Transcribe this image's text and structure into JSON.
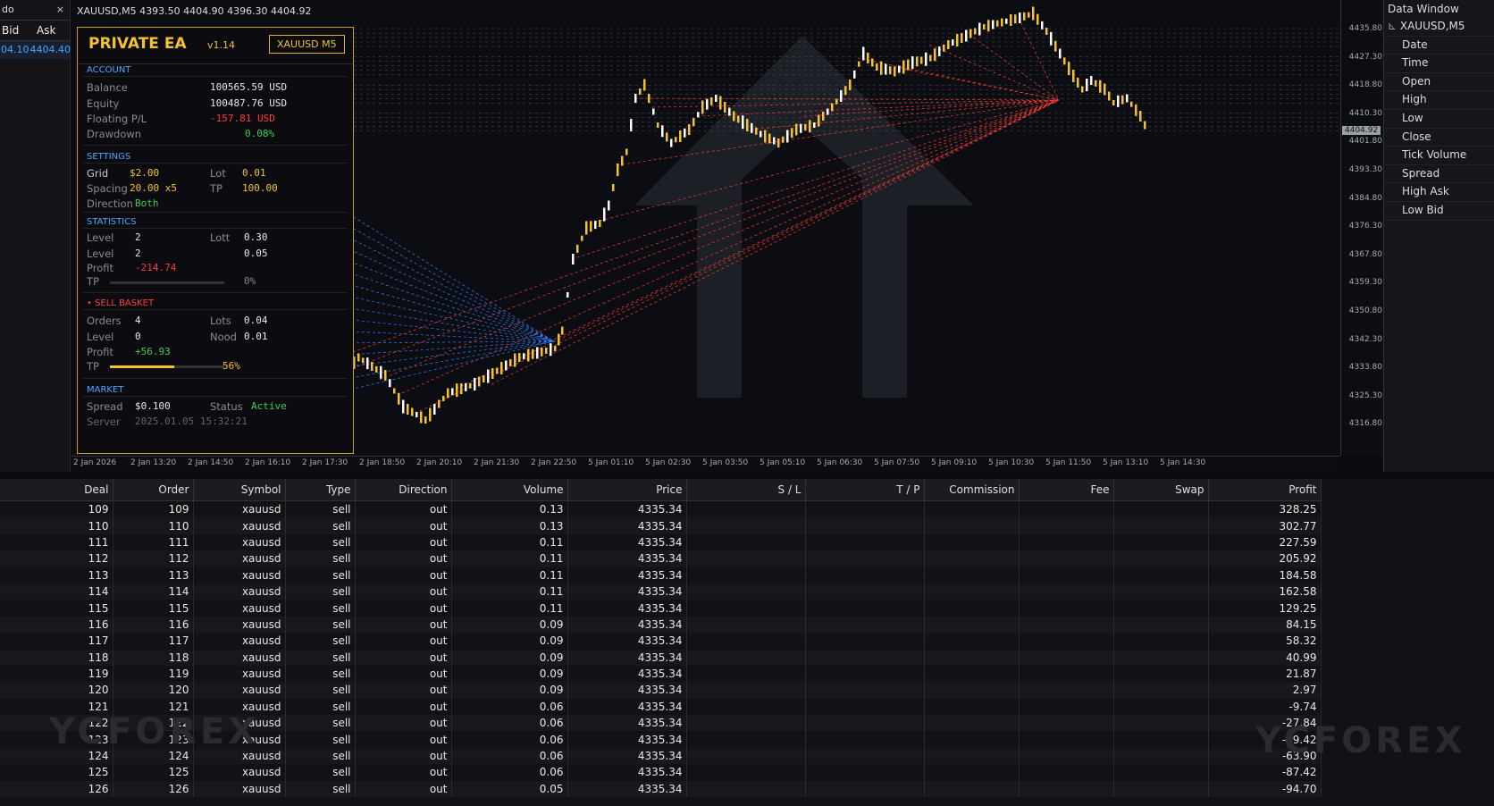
{
  "market_watch": {
    "title": "do",
    "close": "×",
    "col_bid": "Bid",
    "col_ask": "Ask",
    "bid": "04.10",
    "ask": "4404.40"
  },
  "chart": {
    "symbol_line": "XAUUSD,M5  4393.50 4404.90 4396.30 4404.92",
    "current_price": "4404.92",
    "price_ticks": [
      "4435.80",
      "4427.30",
      "4418.80",
      "4410.30",
      "4401.80",
      "4393.30",
      "4384.80",
      "4376.30",
      "4367.80",
      "4359.30",
      "4350.80",
      "4342.30",
      "4333.80",
      "4325.30",
      "4316.80"
    ],
    "time_ticks": [
      "2 Jan 2026",
      "2 Jan 13:20",
      "2 Jan 14:50",
      "2 Jan 16:10",
      "2 Jan 17:30",
      "2 Jan 18:50",
      "2 Jan 20:10",
      "2 Jan 21:30",
      "2 Jan 22:50",
      "5 Jan 01:10",
      "5 Jan 02:30",
      "5 Jan 03:50",
      "5 Jan 05:10",
      "5 Jan 06:30",
      "5 Jan 07:50",
      "5 Jan 09:10",
      "5 Jan 10:30",
      "5 Jan 11:50",
      "5 Jan 13:10",
      "5 Jan 14:30"
    ],
    "colors": {
      "bull": "#f2c231",
      "bear": "#ffffff",
      "sell_line": "#ff3b30",
      "buy_line": "#2f80ff"
    }
  },
  "data_window": {
    "title": "Data Window",
    "symbol": "XAUUSD,M5",
    "items": [
      "Date",
      "Time",
      "Open",
      "High",
      "Low",
      "Close",
      "Tick Volume",
      "Spread",
      "High Ask",
      "Low Bid"
    ]
  },
  "ea": {
    "name": "PRIVATE EA",
    "version": "v1.14",
    "pair": "XAUUSD M5",
    "account": {
      "title": "ACCOUNT",
      "balance_label": "Balance",
      "balance": "100565.59 USD",
      "equity_label": "Equity",
      "equity": "100487.76 USD",
      "fpl_label": "Floating P/L",
      "fpl": "-157.81 USD",
      "dd_label": "Drawdown",
      "dd": "0.08%"
    },
    "settings": {
      "title": "SETTINGS",
      "grid_label": "Grid",
      "grid": "$2.00",
      "lot_label": "Lot",
      "lot": "0.01",
      "spacing_label": "Spacing",
      "spacing": "20.00 x5",
      "tp_label": "TP",
      "tp": "100.00",
      "dir_label": "Direction",
      "dir": "Both"
    },
    "stats": {
      "title": "STATISTICS",
      "level_label": "Level",
      "level": "2",
      "lott_label": "Lott",
      "lott": "0.30",
      "level2_label": "Level",
      "level2": "2",
      "v2": "0.05",
      "profit_label": "Profit",
      "profit": "-214.74",
      "tp_label": "TP",
      "tp_pct": "0%",
      "tp_fill": 0.0
    },
    "sell": {
      "title": "SELL BASKET",
      "orders_label": "Orders",
      "orders": "4",
      "lots_label": "Lots",
      "lots": "0.04",
      "level_label": "Level",
      "level": "0",
      "nood_label": "Nood",
      "nood": "0.01",
      "profit_label": "Profit",
      "profit": "+56.93",
      "tp_label": "TP",
      "tp_pct": "56%",
      "tp_fill": 0.56
    },
    "market": {
      "title": "MARKET",
      "spread_label": "Spread",
      "spread": "$0.100",
      "status_label": "Status",
      "status": "Active",
      "server_label": "Server",
      "server": "2025.01.05 15:32:21"
    }
  },
  "table": {
    "headers": [
      "Deal",
      "Order",
      "Symbol",
      "Type",
      "Direction",
      "Volume",
      "Price",
      "S / L",
      "T / P",
      "Commission",
      "Fee",
      "Swap",
      "Profit"
    ],
    "rows": [
      [
        "109",
        "109",
        "xauusd",
        "sell",
        "out",
        "0.13",
        "4335.34",
        "",
        "",
        "",
        "",
        "",
        "328.25"
      ],
      [
        "110",
        "110",
        "xauusd",
        "sell",
        "out",
        "0.13",
        "4335.34",
        "",
        "",
        "",
        "",
        "",
        "302.77"
      ],
      [
        "111",
        "111",
        "xauusd",
        "sell",
        "out",
        "0.11",
        "4335.34",
        "",
        "",
        "",
        "",
        "",
        "227.59"
      ],
      [
        "112",
        "112",
        "xauusd",
        "sell",
        "out",
        "0.11",
        "4335.34",
        "",
        "",
        "",
        "",
        "",
        "205.92"
      ],
      [
        "113",
        "113",
        "xauusd",
        "sell",
        "out",
        "0.11",
        "4335.34",
        "",
        "",
        "",
        "",
        "",
        "184.58"
      ],
      [
        "114",
        "114",
        "xauusd",
        "sell",
        "out",
        "0.11",
        "4335.34",
        "",
        "",
        "",
        "",
        "",
        "162.58"
      ],
      [
        "115",
        "115",
        "xauusd",
        "sell",
        "out",
        "0.11",
        "4335.34",
        "",
        "",
        "",
        "",
        "",
        "129.25"
      ],
      [
        "116",
        "116",
        "xauusd",
        "sell",
        "out",
        "0.09",
        "4335.34",
        "",
        "",
        "",
        "",
        "",
        "84.15"
      ],
      [
        "117",
        "117",
        "xauusd",
        "sell",
        "out",
        "0.09",
        "4335.34",
        "",
        "",
        "",
        "",
        "",
        "58.32"
      ],
      [
        "118",
        "118",
        "xauusd",
        "sell",
        "out",
        "0.09",
        "4335.34",
        "",
        "",
        "",
        "",
        "",
        "40.99"
      ],
      [
        "119",
        "119",
        "xauusd",
        "sell",
        "out",
        "0.09",
        "4335.34",
        "",
        "",
        "",
        "",
        "",
        "21.87"
      ],
      [
        "120",
        "120",
        "xauusd",
        "sell",
        "out",
        "0.09",
        "4335.34",
        "",
        "",
        "",
        "",
        "",
        "2.97"
      ],
      [
        "121",
        "121",
        "xauusd",
        "sell",
        "out",
        "0.06",
        "4335.34",
        "",
        "",
        "",
        "",
        "",
        "-9.74"
      ],
      [
        "122",
        "122",
        "xauusd",
        "sell",
        "out",
        "0.06",
        "4335.34",
        "",
        "",
        "",
        "",
        "",
        "-27.84"
      ],
      [
        "123",
        "123",
        "xauusd",
        "sell",
        "out",
        "0.06",
        "4335.34",
        "",
        "",
        "",
        "",
        "",
        "-39.42"
      ],
      [
        "124",
        "124",
        "xauusd",
        "sell",
        "out",
        "0.06",
        "4335.34",
        "",
        "",
        "",
        "",
        "",
        "-63.90"
      ],
      [
        "125",
        "125",
        "xauusd",
        "sell",
        "out",
        "0.06",
        "4335.34",
        "",
        "",
        "",
        "",
        "",
        "-87.42"
      ],
      [
        "126",
        "126",
        "xauusd",
        "sell",
        "out",
        "0.05",
        "4335.34",
        "",
        "",
        "",
        "",
        "",
        "-94.70"
      ]
    ],
    "watermark": "YCFOREX"
  }
}
